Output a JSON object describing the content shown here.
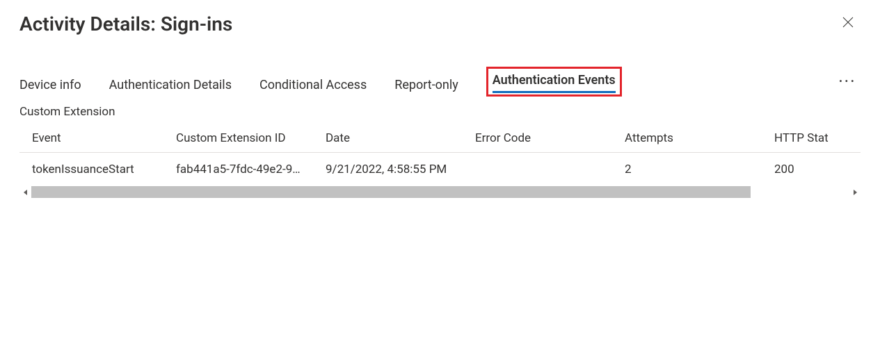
{
  "header": {
    "title": "Activity Details: Sign-ins"
  },
  "tabs": {
    "items": [
      {
        "label": "Device info"
      },
      {
        "label": "Authentication Details"
      },
      {
        "label": "Conditional Access"
      },
      {
        "label": "Report-only"
      },
      {
        "label": "Authentication Events"
      }
    ],
    "active_index": 4,
    "overflow_label": "···"
  },
  "section": {
    "label": "Custom Extension"
  },
  "table": {
    "columns": [
      "Event",
      "Custom Extension ID",
      "Date",
      "Error Code",
      "Attempts",
      "HTTP Stat"
    ],
    "rows": [
      {
        "event": "tokenIssuanceStart",
        "custom_extension_id": "fab441a5-7fdc-49e2-9…",
        "date": "9/21/2022, 4:58:55 PM",
        "error_code": "",
        "attempts": "2",
        "http_stat": "200"
      }
    ]
  }
}
